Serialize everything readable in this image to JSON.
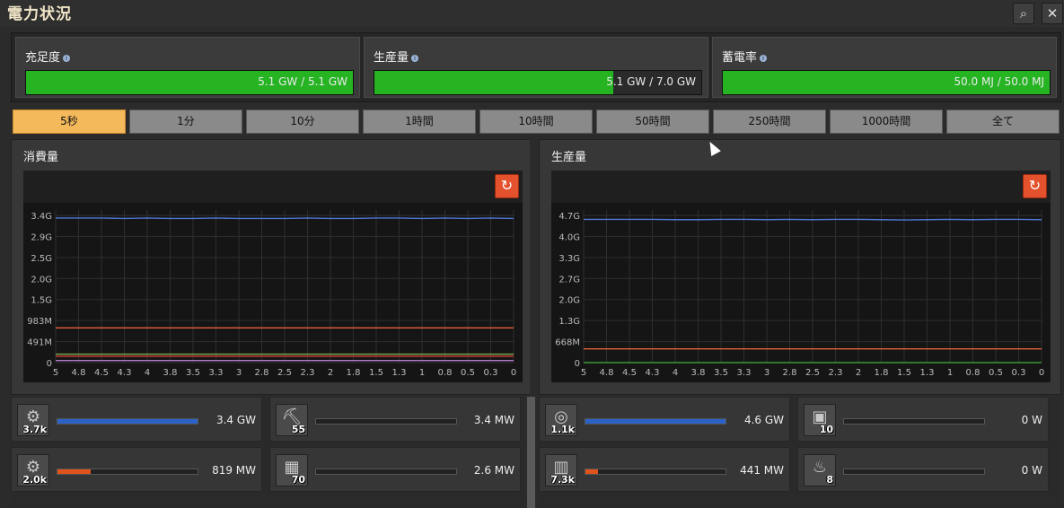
{
  "window": {
    "title": "電力状況",
    "search_icon": "search-icon",
    "close_icon": "close-icon"
  },
  "stats": [
    {
      "label": "充足度",
      "value": "5.1 GW / 5.1 GW",
      "fill": 1.0
    },
    {
      "label": "生産量",
      "value": "5.1 GW / 7.0 GW",
      "fill": 0.73
    },
    {
      "label": "蓄電率",
      "value": "50.0 MJ / 50.0 MJ",
      "fill": 1.0
    }
  ],
  "timescale": {
    "options": [
      "5秒",
      "1分",
      "10分",
      "1時間",
      "10時間",
      "50時間",
      "250時間",
      "1000時間",
      "全て"
    ],
    "selected": "5秒"
  },
  "consumption": {
    "title": "消費量",
    "reset_icon": "reset-icon"
  },
  "production": {
    "title": "生産量",
    "reset_icon": "reset-icon"
  },
  "chart_data": [
    {
      "type": "line",
      "title": "消費量",
      "y_ticks": [
        "3.4G",
        "2.9G",
        "2.5G",
        "2.0G",
        "1.5G",
        "983M",
        "491M",
        "0"
      ],
      "x_ticks": [
        "5",
        "4.8",
        "4.5",
        "4.3",
        "4",
        "3.8",
        "3.5",
        "3.3",
        "3",
        "2.8",
        "2.5",
        "2.3",
        "2",
        "1.8",
        "1.5",
        "1.3",
        "1",
        "0.8",
        "0.5",
        "0.3",
        "0"
      ],
      "ylim": [
        0,
        3.6
      ],
      "xlim": [
        5,
        0
      ],
      "grid": true,
      "series": [
        {
          "color": "#4f78d8",
          "values": [
            3.41,
            3.41,
            3.41,
            3.4,
            3.41,
            3.4,
            3.4,
            3.41,
            3.4,
            3.4,
            3.4,
            3.41,
            3.4,
            3.4,
            3.41,
            3.41,
            3.4,
            3.41,
            3.4,
            3.41,
            3.4
          ]
        },
        {
          "color": "#e0603a",
          "values": [
            0.82,
            0.82,
            0.82,
            0.82,
            0.82,
            0.82,
            0.82,
            0.82,
            0.82,
            0.82,
            0.82,
            0.82,
            0.82,
            0.82,
            0.82,
            0.82,
            0.82,
            0.82,
            0.82,
            0.82,
            0.82
          ]
        },
        {
          "color": "#7fa84a",
          "values": [
            0.2,
            0.2,
            0.2,
            0.2,
            0.2,
            0.2,
            0.2,
            0.2,
            0.2,
            0.2,
            0.2,
            0.2,
            0.2,
            0.2,
            0.2,
            0.2,
            0.2,
            0.2,
            0.2,
            0.2,
            0.2
          ]
        },
        {
          "color": "#d04040",
          "values": [
            0.15,
            0.15,
            0.15,
            0.15,
            0.15,
            0.15,
            0.15,
            0.15,
            0.15,
            0.15,
            0.15,
            0.15,
            0.15,
            0.15,
            0.15,
            0.15,
            0.15,
            0.15,
            0.15,
            0.15,
            0.15
          ]
        },
        {
          "color": "#b07ad0",
          "values": [
            0.05,
            0.05,
            0.05,
            0.05,
            0.05,
            0.05,
            0.05,
            0.05,
            0.05,
            0.05,
            0.05,
            0.05,
            0.05,
            0.05,
            0.05,
            0.05,
            0.05,
            0.05,
            0.05,
            0.05,
            0.05
          ]
        }
      ]
    },
    {
      "type": "line",
      "title": "生産量",
      "y_ticks": [
        "4.7G",
        "4.0G",
        "3.3G",
        "2.7G",
        "2.0G",
        "1.3G",
        "668M",
        "0"
      ],
      "x_ticks": [
        "5",
        "4.8",
        "4.5",
        "4.3",
        "4",
        "3.8",
        "3.5",
        "3.3",
        "3",
        "2.8",
        "2.5",
        "2.3",
        "2",
        "1.8",
        "1.5",
        "1.3",
        "1",
        "0.8",
        "0.5",
        "0.3",
        "0"
      ],
      "ylim": [
        0,
        4.9
      ],
      "xlim": [
        5,
        0
      ],
      "grid": true,
      "series": [
        {
          "color": "#4f78d8",
          "values": [
            4.6,
            4.6,
            4.6,
            4.6,
            4.59,
            4.59,
            4.6,
            4.6,
            4.59,
            4.6,
            4.59,
            4.6,
            4.6,
            4.59,
            4.58,
            4.59,
            4.6,
            4.59,
            4.6,
            4.6,
            4.59
          ]
        },
        {
          "color": "#e0603a",
          "values": [
            0.44,
            0.44,
            0.44,
            0.44,
            0.44,
            0.44,
            0.44,
            0.44,
            0.44,
            0.44,
            0.44,
            0.44,
            0.44,
            0.44,
            0.44,
            0.44,
            0.44,
            0.44,
            0.44,
            0.44,
            0.44
          ]
        },
        {
          "color": "#3a9a3a",
          "values": [
            0.0,
            0.0,
            0.0,
            0.0,
            0.0,
            0.0,
            0.0,
            0.0,
            0.0,
            0.0,
            0.0,
            0.0,
            0.0,
            0.0,
            0.0,
            0.0,
            0.0,
            0.0,
            0.0,
            0.0,
            0.0
          ]
        }
      ]
    }
  ],
  "consumers": [
    {
      "icon": "assembler-icon",
      "count": "3.7k",
      "value": "3.4 GW",
      "fill": 1.0,
      "color": "#2a62c8"
    },
    {
      "icon": "mining-drill-icon",
      "count": "55",
      "value": "3.4 MW",
      "fill": 0.0,
      "color": "#2a62c8"
    },
    {
      "icon": "machine-icon",
      "count": "2.0k",
      "value": "819 MW",
      "fill": 0.24,
      "color": "#e0541c"
    },
    {
      "icon": "beacon-icon",
      "count": "70",
      "value": "2.6 MW",
      "fill": 0.0,
      "color": "#e0541c"
    }
  ],
  "producers": [
    {
      "icon": "steam-turbine-icon",
      "count": "1.1k",
      "value": "4.6 GW",
      "fill": 1.0,
      "color": "#2a62c8"
    },
    {
      "icon": "accumulator-icon",
      "count": "10",
      "value": "0 W",
      "fill": 0.0,
      "color": "#2a62c8"
    },
    {
      "icon": "solar-panel-icon",
      "count": "7.3k",
      "value": "441 MW",
      "fill": 0.09,
      "color": "#e0541c"
    },
    {
      "icon": "engine-icon",
      "count": "8",
      "value": "0 W",
      "fill": 0.0,
      "color": "#e0541c"
    }
  ]
}
